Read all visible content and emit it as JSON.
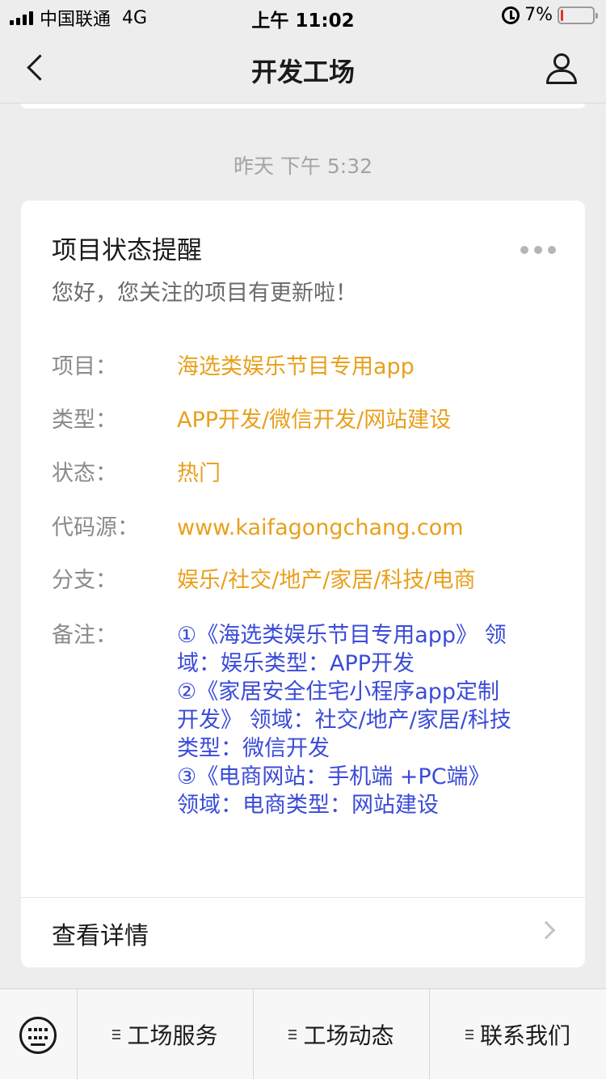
{
  "status_bar": {
    "carrier": "中国联通",
    "network": "4G",
    "time": "上午 11:02",
    "battery_percent": "7%",
    "battery_level": 0.07,
    "battery_color": "#e0332b"
  },
  "nav": {
    "title": "开发工场",
    "back_icon": "chevron-left-icon",
    "user_icon": "user-icon"
  },
  "timestamp": "昨天 下午 5:32",
  "card": {
    "title": "项目状态提醒",
    "subtitle": "您好，您关注的项目有更新啦！",
    "fields": [
      {
        "label": "项目：",
        "value": "海选类娱乐节目专用app"
      },
      {
        "label": "类型：",
        "value": "APP开发/微信开发/网站建设"
      },
      {
        "label": "状态：",
        "value": "热门"
      },
      {
        "label": "代码源：",
        "value": "www.kaifagongchang.com"
      },
      {
        "label": "分支：",
        "value": "娱乐/社交/地产/家居/科技/电商"
      }
    ],
    "remark_label": "备注：",
    "remark_lines": [
      "①《海选类娱乐节目专用app》 领",
      "域：娱乐类型：APP开发",
      "②《家居安全住宅小程序app定制",
      "开发》 领域：社交/地产/家居/科技",
      "类型：微信开发",
      "③《电商网站：手机端 +PC端》",
      "领域：电商类型：网站建设"
    ],
    "detail_label": "查看详情",
    "accent_color": "#e8a01c",
    "remark_color": "#3a4bd8"
  },
  "bottom_bar": {
    "keyboard_icon": "keyboard-icon",
    "menus": [
      "工场服务",
      "工场动态",
      "联系我们"
    ]
  }
}
